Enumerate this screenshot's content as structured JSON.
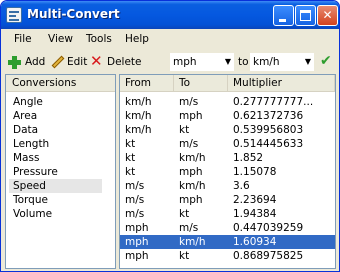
{
  "window": {
    "title": "Multi-Convert"
  },
  "menu": {
    "items": [
      "File",
      "View",
      "Tools",
      "Help"
    ]
  },
  "toolbar": {
    "add_label": "Add",
    "edit_label": "Edit",
    "delete_label": "Delete",
    "from_value": "mph",
    "to_label": "to",
    "to_value": "km/h"
  },
  "conversions": {
    "header": "Conversions",
    "items": [
      "Angle",
      "Area",
      "Data",
      "Length",
      "Mass",
      "Pressure",
      "Speed",
      "Torque",
      "Volume"
    ],
    "selected": "Speed"
  },
  "table": {
    "columns": [
      "From",
      "To",
      "Multiplier"
    ],
    "rows": [
      {
        "from": "km/h",
        "to": "m/s",
        "multiplier": "0.277777777..."
      },
      {
        "from": "km/h",
        "to": "mph",
        "multiplier": "0.621372736"
      },
      {
        "from": "km/h",
        "to": "kt",
        "multiplier": "0.539956803"
      },
      {
        "from": "kt",
        "to": "m/s",
        "multiplier": "0.514445633"
      },
      {
        "from": "kt",
        "to": "km/h",
        "multiplier": "1.852"
      },
      {
        "from": "kt",
        "to": "mph",
        "multiplier": "1.15078"
      },
      {
        "from": "m/s",
        "to": "km/h",
        "multiplier": "3.6"
      },
      {
        "from": "m/s",
        "to": "mph",
        "multiplier": "2.23694"
      },
      {
        "from": "m/s",
        "to": "kt",
        "multiplier": "1.94384"
      },
      {
        "from": "mph",
        "to": "m/s",
        "multiplier": "0.447039259"
      },
      {
        "from": "mph",
        "to": "km/h",
        "multiplier": "1.60934"
      },
      {
        "from": "mph",
        "to": "kt",
        "multiplier": "0.868975825"
      }
    ],
    "selected_index": 10
  },
  "colors": {
    "title_bar": "#0558e0",
    "selection": "#316ac5",
    "window_face": "#ece9d8"
  }
}
